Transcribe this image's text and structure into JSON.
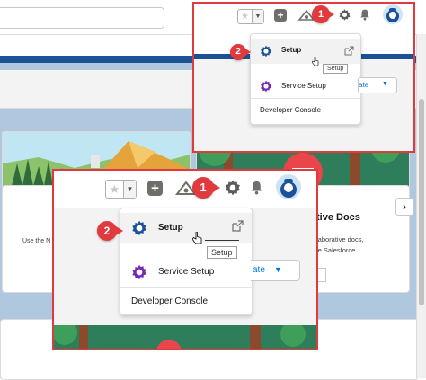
{
  "callout_large": {
    "badge_1": "1",
    "badge_2": "2",
    "menu": {
      "setup_label": "Setup",
      "service_setup_label": "Service Setup",
      "developer_console_label": "Developer Console",
      "tooltip": "Setup"
    },
    "partial_button_label": "ate",
    "behind_text": {
      "heading_fragment": "tive Docs",
      "line1": "laborative docs,",
      "line2": "le Salesforce."
    }
  },
  "callout_small": {
    "badge_1": "1",
    "badge_2": "2",
    "menu": {
      "setup_label": "Setup",
      "service_setup_label": "Service Setup",
      "developer_console_label": "Developer Console",
      "tooltip": "Setup"
    },
    "partial_button_label": "ate"
  },
  "background": {
    "card_text_fragment": "Use the N"
  },
  "colors": {
    "callout_red": "#e03a3e",
    "salesforce_blue": "#1b5297",
    "gear_blue": "#1b5297",
    "service_purple": "#7526b5"
  }
}
